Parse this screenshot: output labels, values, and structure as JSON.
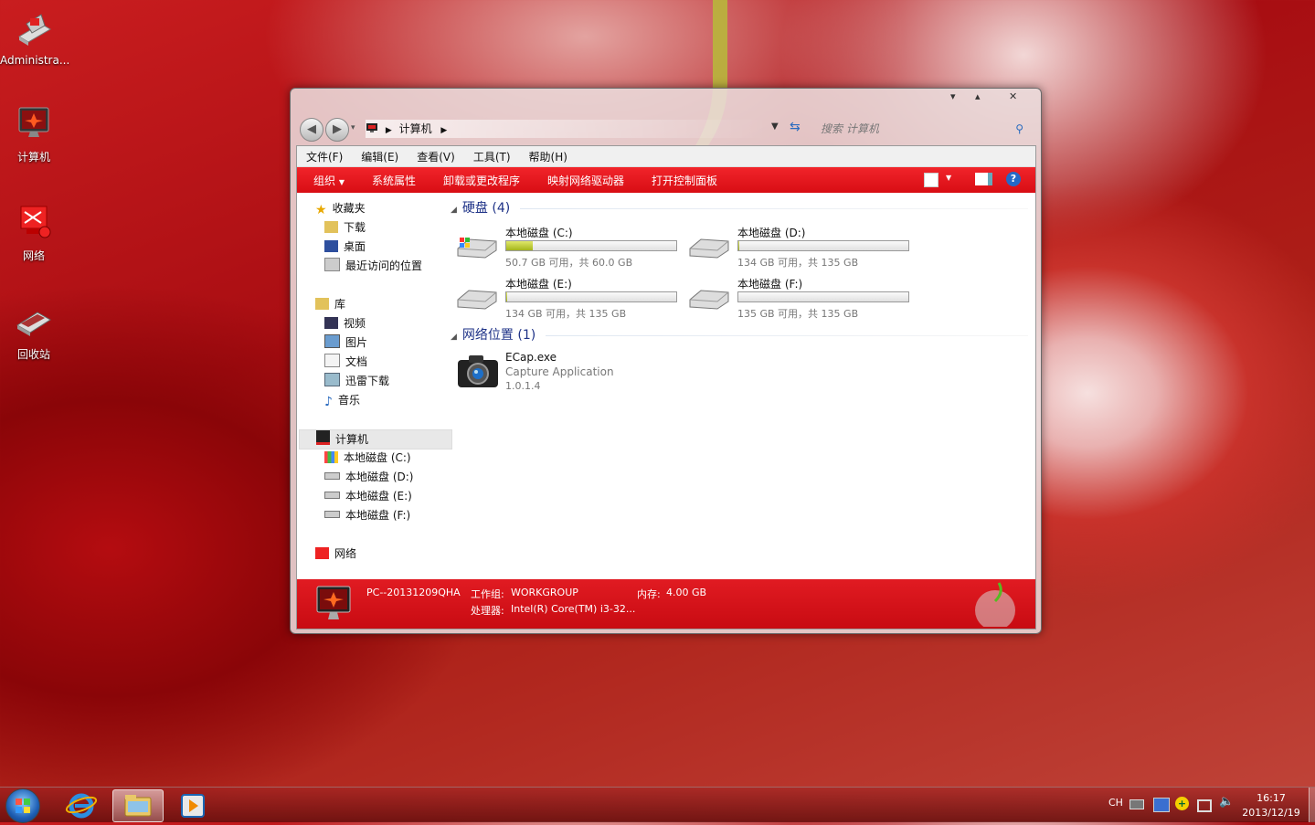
{
  "desktop": {
    "icons": [
      {
        "label": "Administra..."
      },
      {
        "label": "计算机"
      },
      {
        "label": "网络"
      },
      {
        "label": "回收站"
      }
    ]
  },
  "window": {
    "controls": {
      "minimize": "▾",
      "maximize": "▴",
      "close": "✕"
    },
    "address": {
      "back": "◀",
      "forward": "▶",
      "crumb": "计算机",
      "search_placeholder": "搜索 计算机"
    },
    "menu": [
      "文件(F)",
      "编辑(E)",
      "查看(V)",
      "工具(T)",
      "帮助(H)"
    ],
    "commands": [
      "组织",
      "系统属性",
      "卸载或更改程序",
      "映射网络驱动器",
      "打开控制面板"
    ],
    "nav": {
      "favorites": {
        "label": "收藏夹",
        "items": [
          "下载",
          "桌面",
          "最近访问的位置"
        ]
      },
      "libraries": {
        "label": "库",
        "items": [
          "视频",
          "图片",
          "文档",
          "迅雷下载",
          "音乐"
        ]
      },
      "computer": {
        "label": "计算机",
        "items": [
          "本地磁盘 (C:)",
          "本地磁盘 (D:)",
          "本地磁盘 (E:)",
          "本地磁盘 (F:)"
        ]
      },
      "network": {
        "label": "网络"
      }
    },
    "groups": {
      "drives_header": "硬盘 (4)",
      "network_header": "网络位置 (1)"
    },
    "drives": [
      {
        "name": "本地磁盘 (C:)",
        "size": "50.7 GB 可用，共 60.0 GB",
        "used_fraction": 0.155
      },
      {
        "name": "本地磁盘 (D:)",
        "size": "134 GB 可用，共 135 GB",
        "used_fraction": 0.007
      },
      {
        "name": "本地磁盘 (E:)",
        "size": "134 GB 可用，共 135 GB",
        "used_fraction": 0.007
      },
      {
        "name": "本地磁盘 (F:)",
        "size": "135 GB 可用，共 135 GB",
        "used_fraction": 0.0
      }
    ],
    "network_item": {
      "name": "ECap.exe",
      "desc": "Capture Application",
      "version": "1.0.1.4"
    },
    "status": {
      "pc": "PC--20131209QHA",
      "workgroup_label": "工作组:",
      "workgroup": "WORKGROUP",
      "memory_label": "内存:",
      "memory": "4.00 GB",
      "cpu_label": "处理器:",
      "cpu": "Intel(R) Core(TM) i3-32..."
    }
  },
  "taskbar": {
    "lang": "CH",
    "time": "16:17",
    "date": "2013/12/19"
  },
  "colors": {
    "accent": "#e0141b",
    "link": "#1e3287"
  }
}
